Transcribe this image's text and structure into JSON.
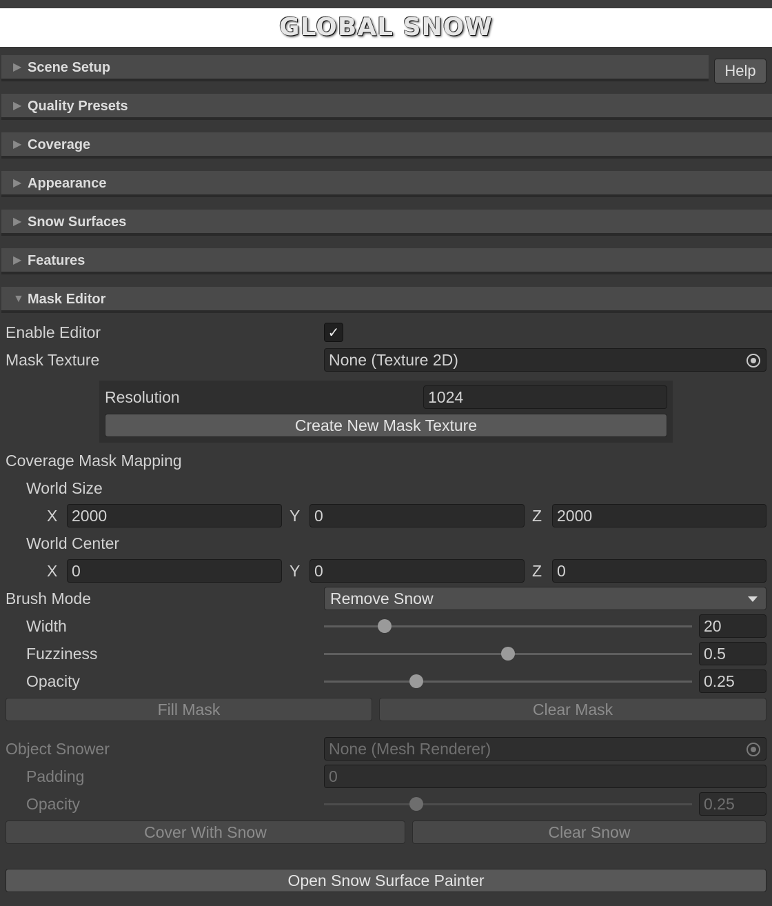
{
  "logo": {
    "text": "GLOBAL SNOW"
  },
  "sections": [
    {
      "label": "Scene Setup",
      "expanded": false
    },
    {
      "label": "Quality Presets",
      "expanded": false
    },
    {
      "label": "Coverage",
      "expanded": false
    },
    {
      "label": "Appearance",
      "expanded": false
    },
    {
      "label": "Snow Surfaces",
      "expanded": false
    },
    {
      "label": "Features",
      "expanded": false
    },
    {
      "label": "Mask Editor",
      "expanded": true
    }
  ],
  "help_button": "Help",
  "collapsed_icon": "triangle-right-icon",
  "expanded_icon": "triangle-down-icon",
  "mask_editor": {
    "enable_editor": {
      "label": "Enable Editor",
      "checked": true,
      "check_glyph": "✓"
    },
    "mask_texture": {
      "label": "Mask Texture",
      "value": "None (Texture 2D)"
    },
    "resolution": {
      "label": "Resolution",
      "value": "1024"
    },
    "create_button": "Create New Mask Texture",
    "coverage_mapping": {
      "label": "Coverage Mask Mapping",
      "world_size": {
        "label": "World Size",
        "x_label": "X",
        "x": "2000",
        "y_label": "Y",
        "y": "0",
        "z_label": "Z",
        "z": "2000"
      },
      "world_center": {
        "label": "World Center",
        "x_label": "X",
        "x": "0",
        "y_label": "Y",
        "y": "0",
        "z_label": "Z",
        "z": "0"
      }
    },
    "brush_mode": {
      "label": "Brush Mode",
      "value": "Remove Snow"
    },
    "width": {
      "label": "Width",
      "value": "20",
      "slider_fraction": 0.165
    },
    "fuzziness": {
      "label": "Fuzziness",
      "value": "0.5",
      "slider_fraction": 0.5
    },
    "opacity": {
      "label": "Opacity",
      "value": "0.25",
      "slider_fraction": 0.25
    },
    "fill_mask_button": "Fill Mask",
    "clear_mask_button": "Clear Mask",
    "object_snower": {
      "label": "Object Snower",
      "value": "None (Mesh Renderer)"
    },
    "padding": {
      "label": "Padding",
      "value": "0"
    },
    "object_opacity": {
      "label": "Opacity",
      "value": "0.25",
      "slider_fraction": 0.25
    },
    "cover_button": "Cover With Snow",
    "clear_snow_button": "Clear Snow",
    "open_painter_button": "Open Snow Surface Painter"
  }
}
